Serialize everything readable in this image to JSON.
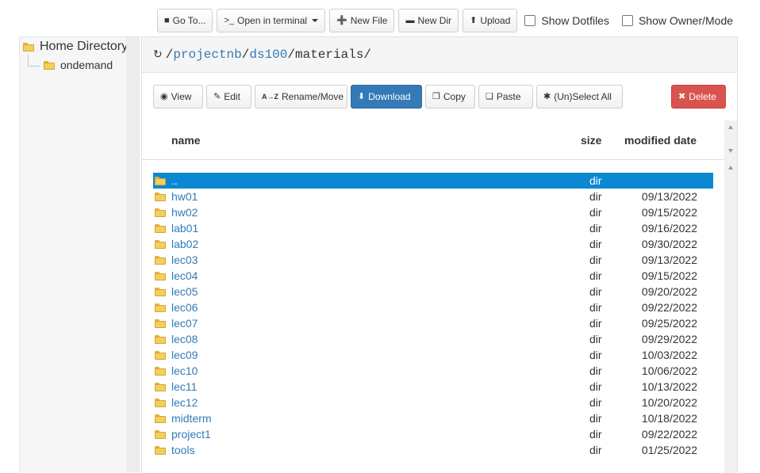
{
  "toolbar": {
    "goto": "Go To...",
    "terminal": "Open in terminal",
    "new_file": "New File",
    "new_dir": "New Dir",
    "upload": "Upload",
    "show_dotfiles": "Show Dotfiles",
    "show_owner": "Show Owner/Mode"
  },
  "tree": {
    "root": "Home Directory",
    "child": "ondemand"
  },
  "path": {
    "sep": "/",
    "segments": [
      "projectnb",
      "ds100",
      "materials"
    ]
  },
  "actions": {
    "view": "View",
    "edit": "Edit",
    "rename": "Rename/Move",
    "download": "Download",
    "copy": "Copy",
    "paste": "Paste",
    "select_all": "(Un)Select All",
    "delete": "Delete"
  },
  "table": {
    "headers": {
      "name": "name",
      "size": "size",
      "modified": "modified date"
    },
    "rows": [
      {
        "name": "..",
        "size": "dir",
        "date": "",
        "selected": true
      },
      {
        "name": "hw01",
        "size": "dir",
        "date": "09/13/2022"
      },
      {
        "name": "hw02",
        "size": "dir",
        "date": "09/15/2022"
      },
      {
        "name": "lab01",
        "size": "dir",
        "date": "09/16/2022"
      },
      {
        "name": "lab02",
        "size": "dir",
        "date": "09/30/2022"
      },
      {
        "name": "lec03",
        "size": "dir",
        "date": "09/13/2022"
      },
      {
        "name": "lec04",
        "size": "dir",
        "date": "09/15/2022"
      },
      {
        "name": "lec05",
        "size": "dir",
        "date": "09/20/2022"
      },
      {
        "name": "lec06",
        "size": "dir",
        "date": "09/22/2022"
      },
      {
        "name": "lec07",
        "size": "dir",
        "date": "09/25/2022"
      },
      {
        "name": "lec08",
        "size": "dir",
        "date": "09/29/2022"
      },
      {
        "name": "lec09",
        "size": "dir",
        "date": "10/03/2022"
      },
      {
        "name": "lec10",
        "size": "dir",
        "date": "10/06/2022"
      },
      {
        "name": "lec11",
        "size": "dir",
        "date": "10/13/2022"
      },
      {
        "name": "lec12",
        "size": "dir",
        "date": "10/20/2022"
      },
      {
        "name": "midterm",
        "size": "dir",
        "date": "10/18/2022"
      },
      {
        "name": "project1",
        "size": "dir",
        "date": "09/22/2022"
      },
      {
        "name": "tools",
        "size": "dir",
        "date": "01/25/2022"
      }
    ]
  },
  "colors": {
    "link": "#337ab7",
    "selected_row": "#0a88d2",
    "primary": "#337ab7",
    "danger": "#d9534f"
  }
}
